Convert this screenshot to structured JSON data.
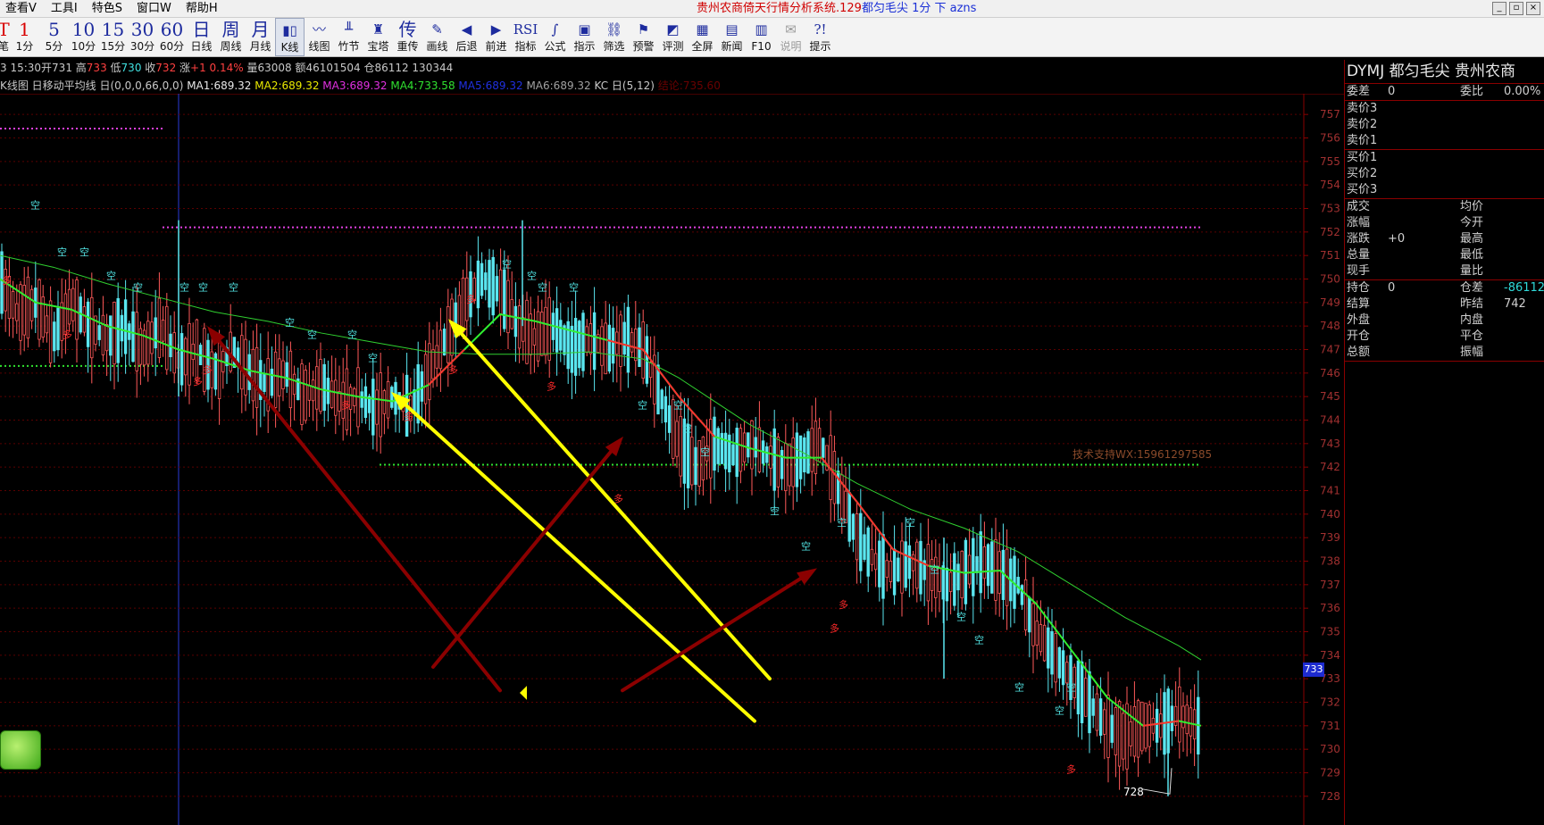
{
  "menu": [
    "查看V",
    "工具I",
    "特色S",
    "窗口W",
    "帮助H"
  ],
  "title": {
    "app": "贵州农商倚天行情分析系统.129",
    "symbol": "都匀毛尖 1分 下 azns"
  },
  "window_buttons": [
    "_",
    "▫",
    "×"
  ],
  "toolbar": [
    {
      "glyph": "T",
      "label": "笔",
      "red": true,
      "first": true
    },
    {
      "glyph": "1",
      "label": "1分",
      "red": true
    },
    {
      "glyph": "5",
      "label": "5分"
    },
    {
      "glyph": "10",
      "label": "10分"
    },
    {
      "glyph": "15",
      "label": "15分"
    },
    {
      "glyph": "30",
      "label": "30分"
    },
    {
      "glyph": "60",
      "label": "60分"
    },
    {
      "glyph": "日",
      "label": "日线"
    },
    {
      "glyph": "周",
      "label": "周线"
    },
    {
      "glyph": "月",
      "label": "月线"
    },
    {
      "glyph": "▮▯",
      "label": "K线",
      "active": true,
      "sm": true
    },
    {
      "glyph": "〰",
      "label": "线图",
      "sm": true
    },
    {
      "glyph": "╨",
      "label": "竹节",
      "sm": true
    },
    {
      "glyph": "♜",
      "label": "宝塔",
      "sm": true
    },
    {
      "glyph": "传",
      "label": "重传"
    },
    {
      "glyph": "✎",
      "label": "画线",
      "sm": true
    },
    {
      "glyph": "◀",
      "label": "后退",
      "sm": true
    },
    {
      "glyph": "▶",
      "label": "前进",
      "sm": true
    },
    {
      "glyph": "RSI",
      "label": "指标",
      "sm": true
    },
    {
      "glyph": "∫",
      "label": "公式",
      "sm": true
    },
    {
      "glyph": "▣",
      "label": "指示",
      "sm": true
    },
    {
      "glyph": "⛓",
      "label": "筛选",
      "sm": true
    },
    {
      "glyph": "⚑",
      "label": "预警",
      "sm": true
    },
    {
      "glyph": "◩",
      "label": "评测",
      "sm": true
    },
    {
      "glyph": "▦",
      "label": "全屏",
      "sm": true
    },
    {
      "glyph": "▤",
      "label": "新闻",
      "sm": true
    },
    {
      "glyph": "▥",
      "label": "F10",
      "sm": true
    },
    {
      "glyph": "✉",
      "label": "说明",
      "sm": true,
      "disabled": true
    },
    {
      "glyph": "?!",
      "label": "提示",
      "sm": true
    }
  ],
  "quote_line": {
    "time": "3 15:30",
    "open_label": "开",
    "open": "731",
    "high_label": "高",
    "high": "733",
    "low_label": "低",
    "low": "730",
    "close_label": "收",
    "close": "732",
    "chg_label": "涨",
    "chg": "+1 0.14%",
    "vol": "量63008",
    "amt": "额46101504",
    "oi": "仓86112 130344"
  },
  "indicator_line": [
    {
      "text": "K线图 日移动平均线 日(0,0,0,66,0,0)",
      "color": "#c8c8c8"
    },
    {
      "text": "MA1:689.32",
      "color": "#e8e8e8"
    },
    {
      "text": "MA2:689.32",
      "color": "#e8e800"
    },
    {
      "text": "MA3:689.32",
      "color": "#e030e0"
    },
    {
      "text": "MA4:733.58",
      "color": "#30e030"
    },
    {
      "text": "MA5:689.32",
      "color": "#2030e0"
    },
    {
      "text": "MA6:689.32",
      "color": "#a0a0a0"
    },
    {
      "text": "KC 日(5,12)",
      "color": "#c8c8c8"
    },
    {
      "text": "结论:735.60",
      "color": "#6a0000"
    }
  ],
  "chart_data": {
    "type": "candlestick",
    "interval": "1分",
    "ylim": [
      727.5,
      757.5
    ],
    "yticks": [
      757,
      756,
      755,
      754,
      753,
      752,
      751,
      750,
      749,
      748,
      747,
      746,
      745,
      744,
      743,
      742,
      741,
      740,
      739,
      738,
      737,
      736,
      735,
      734,
      733,
      732,
      731,
      730,
      729,
      728
    ],
    "current_price": "733",
    "low_marker": "728",
    "price_path": [
      [
        0,
        750
      ],
      [
        20,
        748.5
      ],
      [
        40,
        749
      ],
      [
        60,
        747.5
      ],
      [
        80,
        749
      ],
      [
        100,
        748
      ],
      [
        120,
        747.5
      ],
      [
        140,
        748
      ],
      [
        160,
        747
      ],
      [
        180,
        748
      ],
      [
        200,
        746.5
      ],
      [
        220,
        747
      ],
      [
        240,
        746
      ],
      [
        260,
        747
      ],
      [
        280,
        746
      ],
      [
        300,
        745.5
      ],
      [
        320,
        746
      ],
      [
        340,
        745
      ],
      [
        360,
        745.5
      ],
      [
        380,
        744.8
      ],
      [
        400,
        745
      ],
      [
        420,
        744.5
      ],
      [
        440,
        745
      ],
      [
        460,
        744.5
      ],
      [
        480,
        746
      ],
      [
        500,
        747.5
      ],
      [
        520,
        749
      ],
      [
        540,
        750
      ],
      [
        560,
        749.5
      ],
      [
        580,
        748
      ],
      [
        600,
        747.5
      ],
      [
        620,
        748
      ],
      [
        640,
        747
      ],
      [
        660,
        747.5
      ],
      [
        680,
        747
      ],
      [
        700,
        747.5
      ],
      [
        720,
        747
      ],
      [
        740,
        745
      ],
      [
        760,
        743
      ],
      [
        780,
        742
      ],
      [
        800,
        743
      ],
      [
        820,
        742.5
      ],
      [
        840,
        743
      ],
      [
        860,
        742.5
      ],
      [
        880,
        742
      ],
      [
        900,
        742.5
      ],
      [
        920,
        743
      ],
      [
        940,
        741
      ],
      [
        960,
        739
      ],
      [
        980,
        738
      ],
      [
        1000,
        737.5
      ],
      [
        1020,
        738
      ],
      [
        1040,
        737.5
      ],
      [
        1060,
        737
      ],
      [
        1080,
        737.5
      ],
      [
        1100,
        738
      ],
      [
        1120,
        737.5
      ],
      [
        1140,
        737
      ],
      [
        1160,
        735
      ],
      [
        1180,
        734
      ],
      [
        1200,
        733
      ],
      [
        1220,
        732
      ],
      [
        1240,
        731
      ],
      [
        1260,
        730.5
      ],
      [
        1280,
        731
      ],
      [
        1300,
        731
      ],
      [
        1320,
        731.5
      ],
      [
        1340,
        731
      ]
    ],
    "ma_fast_green": [
      [
        0,
        750
      ],
      [
        40,
        749
      ],
      [
        80,
        748.7
      ],
      [
        120,
        748
      ],
      [
        160,
        747.6
      ],
      [
        200,
        747
      ],
      [
        240,
        746.6
      ],
      [
        280,
        746.1
      ],
      [
        320,
        745.8
      ],
      [
        360,
        745.3
      ],
      [
        400,
        745
      ],
      [
        440,
        744.8
      ],
      [
        480,
        745.5
      ],
      [
        520,
        747
      ],
      [
        560,
        748.5
      ],
      [
        600,
        748.2
      ],
      [
        640,
        747.8
      ],
      [
        680,
        747.4
      ],
      [
        720,
        747
      ],
      [
        760,
        745
      ],
      [
        800,
        743.3
      ],
      [
        840,
        742.8
      ],
      [
        880,
        742.4
      ],
      [
        920,
        742.4
      ],
      [
        960,
        740.5
      ],
      [
        1000,
        738.5
      ],
      [
        1040,
        737.8
      ],
      [
        1080,
        737.5
      ],
      [
        1120,
        737.6
      ],
      [
        1160,
        736.2
      ],
      [
        1200,
        734.2
      ],
      [
        1240,
        732.2
      ],
      [
        1280,
        731
      ],
      [
        1320,
        731.2
      ],
      [
        1345,
        731
      ]
    ],
    "ma_slow_green": [
      [
        0,
        751
      ],
      [
        60,
        750.5
      ],
      [
        120,
        749.8
      ],
      [
        180,
        749.2
      ],
      [
        240,
        748.6
      ],
      [
        300,
        748.2
      ],
      [
        360,
        747.7
      ],
      [
        420,
        747.3
      ],
      [
        480,
        746.9
      ],
      [
        540,
        746.8
      ],
      [
        600,
        746.8
      ],
      [
        660,
        746.9
      ],
      [
        720,
        746.6
      ],
      [
        760,
        745.8
      ],
      [
        800,
        744.8
      ],
      [
        840,
        743.8
      ],
      [
        900,
        742.6
      ],
      [
        960,
        741.3
      ],
      [
        1020,
        740.2
      ],
      [
        1080,
        739.4
      ],
      [
        1140,
        738.4
      ],
      [
        1200,
        737
      ],
      [
        1260,
        735.6
      ],
      [
        1320,
        734.4
      ],
      [
        1345,
        733.8
      ]
    ],
    "signals_empty": [
      [
        40,
        753
      ],
      [
        70,
        751
      ],
      [
        95,
        751
      ],
      [
        125,
        750
      ],
      [
        155,
        749.5
      ],
      [
        207,
        749.5
      ],
      [
        228,
        749.5
      ],
      [
        262,
        749.5
      ],
      [
        325,
        748
      ],
      [
        350,
        747.5
      ],
      [
        395,
        747.5
      ],
      [
        418,
        746.5
      ],
      [
        568,
        750.5
      ],
      [
        596,
        750
      ],
      [
        608,
        749.5
      ],
      [
        643,
        749.5
      ],
      [
        720,
        744.5
      ],
      [
        760,
        744.5
      ],
      [
        770,
        743.5
      ],
      [
        790,
        742.5
      ],
      [
        868,
        740
      ],
      [
        903,
        738.5
      ],
      [
        943,
        739.5
      ],
      [
        1020,
        739.5
      ],
      [
        1047,
        737.5
      ],
      [
        1077,
        735.5
      ],
      [
        1097,
        734.5
      ],
      [
        1142,
        732.5
      ],
      [
        1187,
        731.5
      ],
      [
        1200,
        732.5
      ]
    ],
    "signals_long": [
      [
        8,
        749.8
      ],
      [
        76,
        747.5
      ],
      [
        222,
        745.5
      ],
      [
        233,
        746
      ],
      [
        388,
        744.5
      ],
      [
        458,
        744
      ],
      [
        508,
        746
      ],
      [
        528,
        749
      ],
      [
        618,
        745.3
      ],
      [
        693,
        740.5
      ],
      [
        935,
        735
      ],
      [
        945,
        736
      ],
      [
        1200,
        729
      ]
    ],
    "dotted_levels": [
      {
        "y": 756.4,
        "x0": 0,
        "x1": 182,
        "color": "#e040e0"
      },
      {
        "y": 752.2,
        "x0": 182,
        "x1": 1345,
        "color": "#e040e0"
      },
      {
        "y": 746.3,
        "x0": 0,
        "x1": 182,
        "color": "#30e030"
      },
      {
        "y": 742.1,
        "x0": 425,
        "x1": 1345,
        "color": "#30e030"
      }
    ],
    "arrows": [
      {
        "from": [
          560,
          732.5
        ],
        "to": [
          232,
          748.0
        ],
        "color": "#8b0000",
        "width": 4
      },
      {
        "from": [
          845,
          731.2
        ],
        "to": [
          438,
          745.2
        ],
        "color": "#ffff00",
        "width": 4
      },
      {
        "from": [
          862,
          733.0
        ],
        "to": [
          502,
          748.3
        ],
        "color": "#ffff00",
        "width": 4
      },
      {
        "from": [
          485,
          733.5
        ],
        "to": [
          698,
          743.3
        ],
        "color": "#8b0000",
        "width": 4
      },
      {
        "from": [
          697,
          732.5
        ],
        "to": [
          915,
          737.7
        ],
        "color": "#8b0000",
        "width": 4
      }
    ],
    "watermark": "技术支持WX:15961297585"
  },
  "panel": {
    "header": "DYMJ  都匀毛尖  贵州农商",
    "row_wc": {
      "k1": "委差",
      "v1": "0",
      "k2": "委比",
      "v2": "0.00%"
    },
    "sells": [
      "卖价3",
      "卖价2",
      "卖价1"
    ],
    "buys": [
      "买价1",
      "买价2",
      "买价3"
    ],
    "stats": [
      {
        "k1": "成交",
        "v1": "",
        "k2": "均价",
        "v2": ""
      },
      {
        "k1": "涨幅",
        "v1": "",
        "k2": "今开",
        "v2": ""
      },
      {
        "k1": "涨跌",
        "v1": "+0",
        "k2": "最高",
        "v2": ""
      },
      {
        "k1": "总量",
        "v1": "",
        "k2": "最低",
        "v2": ""
      },
      {
        "k1": "现手",
        "v1": "",
        "k2": "量比",
        "v2": ""
      }
    ],
    "positions": [
      {
        "k1": "持仓",
        "v1": "0",
        "k2": "仓差",
        "v2": "-86112",
        "cyan": true
      },
      {
        "k1": "结算",
        "v1": "",
        "k2": "昨结",
        "v2": "742"
      },
      {
        "k1": "外盘",
        "v1": "",
        "k2": "内盘",
        "v2": ""
      },
      {
        "k1": "开仓",
        "v1": "",
        "k2": "平仓",
        "v2": ""
      },
      {
        "k1": "总额",
        "v1": "",
        "k2": "振幅",
        "v2": ""
      }
    ]
  }
}
